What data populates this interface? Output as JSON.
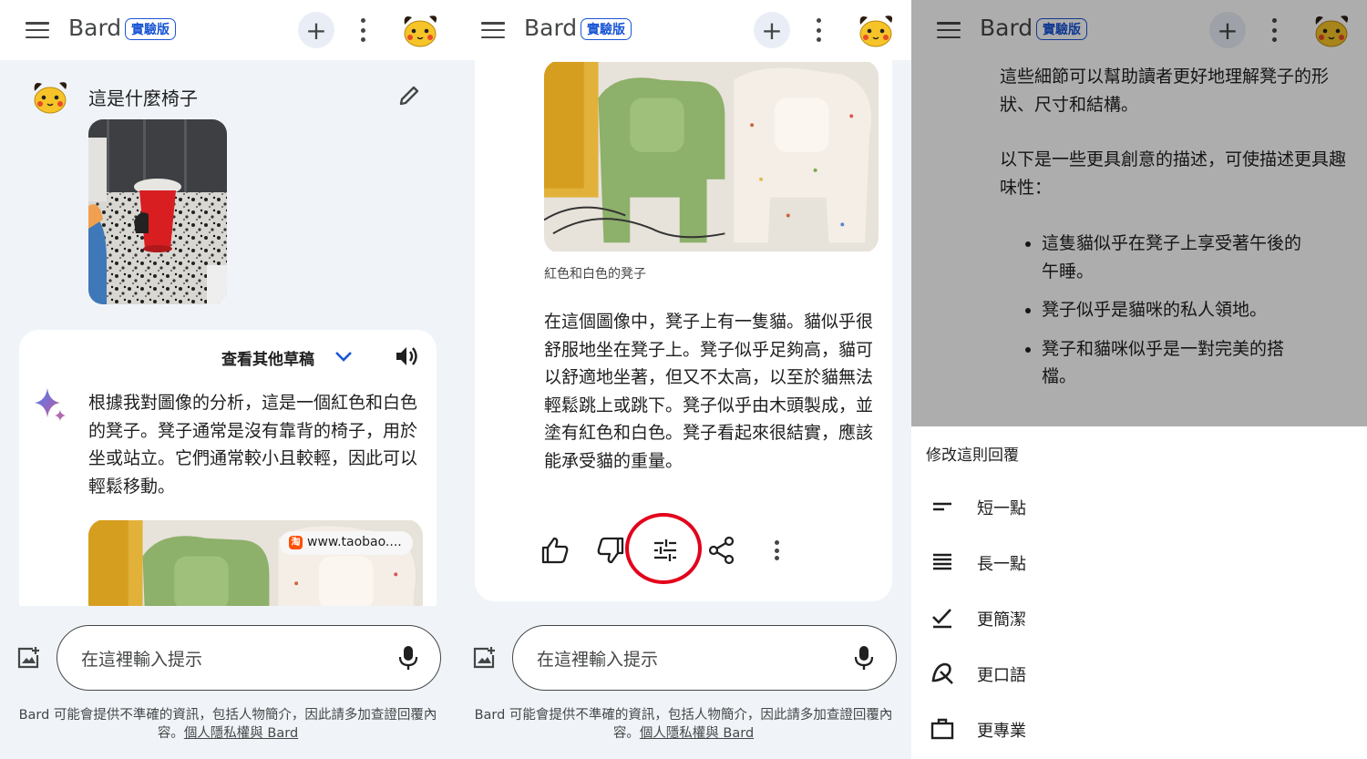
{
  "app": {
    "brand": "Bard",
    "badge": "實驗版"
  },
  "colors": {
    "accent": "#1a56d6",
    "annotation_circle": "#e3001b",
    "bg": "#f0f4f9"
  },
  "panel1": {
    "prompt": "這是什麼椅子",
    "drafts_label": "查看其他草稿",
    "response": "根據我對圖像的分析，這是一個紅色和白色的凳子。凳子通常是沒有靠背的椅子，用於坐或站立。它們通常較小且較輕，因此可以輕鬆移動。",
    "source_chip": "www.taobao...."
  },
  "panel2": {
    "caption": "紅色和白色的凳子",
    "response": "在這個圖像中，凳子上有一隻貓。貓似乎很舒服地坐在凳子上。凳子似乎足夠高，貓可以舒適地坐著，但又不太高，以至於貓無法輕鬆跳上或跳下。凳子似乎由木頭製成，並塗有紅色和白色。凳子看起來很結實，應該能承受貓的重量。"
  },
  "panel3": {
    "para1": "這些細節可以幫助讀者更好地理解凳子的形狀、尺寸和結構。",
    "para2": "以下是一些更具創意的描述，可使描述更具趣味性：",
    "bullets": [
      "這隻貓似乎在凳子上享受著午後的午睡。",
      "凳子似乎是貓咪的私人領地。",
      "凳子和貓咪似乎是一對完美的搭檔。"
    ],
    "sheet_title": "修改這則回覆",
    "options": [
      "短一點",
      "長一點",
      "更簡潔",
      "更口語",
      "更專業"
    ]
  },
  "input": {
    "placeholder": "在這裡輸入提示"
  },
  "footer": {
    "text": "Bard 可能會提供不準確的資訊，包括人物簡介，因此請多加查證回覆內容。",
    "link": "個人隱私權與 Bard"
  },
  "icons": [
    "menu-icon",
    "plus-icon",
    "more-vert-icon",
    "pikachu-avatar",
    "pencil-icon",
    "chevron-down-icon",
    "speaker-icon",
    "sparkle-icon",
    "add-image-icon",
    "mic-icon",
    "thumb-up-icon",
    "thumb-down-icon",
    "tune-icon",
    "share-icon",
    "short-text-icon",
    "long-text-icon",
    "check-icon",
    "casual-icon",
    "briefcase-icon"
  ]
}
